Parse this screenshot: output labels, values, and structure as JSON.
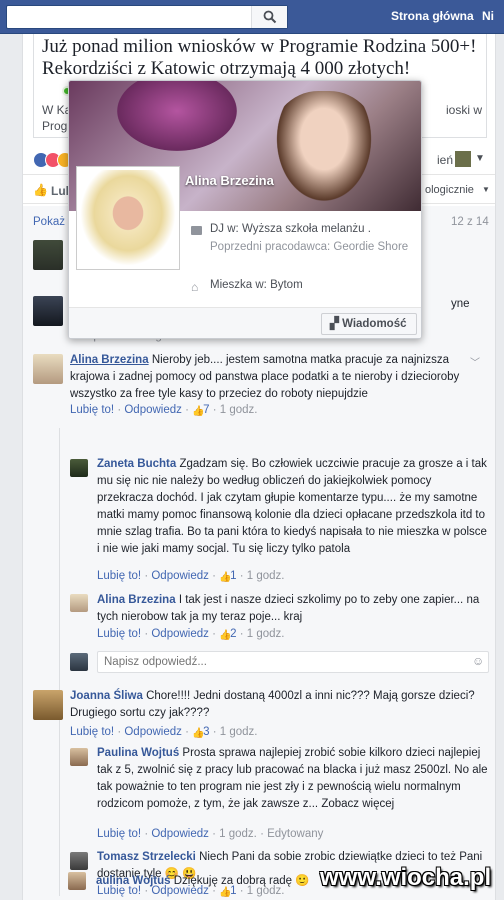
{
  "topbar": {
    "home": "Strona główna",
    "profile_initial": "Ni"
  },
  "post": {
    "title": "Już ponad milion wniosków w Programie Rodzina 500+! Rekordziści z Katowic otrzymają 4 000 złotych!",
    "excerpt_left": "W Ka\nProg",
    "excerpt_right": "ioski w",
    "reactions_right": "ień",
    "share_label": "Lub",
    "sort_label": "ologicznie",
    "show_more": "Pokaż w",
    "count": "12 z 14",
    "partial_text_2": "yne",
    "partial_link": "· Odpowiedz · 1 godz."
  },
  "hover_card": {
    "name": "Alina Brzezina",
    "work": "DJ w: Wyższa szkoła melanżu .",
    "prev_employer": "Poprzedni pracodawca: Geordie Shore",
    "lives": "Mieszka w: Bytom",
    "message_button": "Wiadomość",
    "exclaim": "!"
  },
  "comments": [
    {
      "name": "Alina Brzezina",
      "text": "Nieroby jeb.... jestem samotna matka pracuje za najnizsza krajowa i zadnej pomocy od panstwa place podatki a te nieroby i dziecioroby wszystko za free tyle kasy to przeciez do roboty niepujdzie",
      "like": "Lubię to!",
      "reply": "Odpowiedz",
      "likes": "7",
      "time": "1 godz."
    },
    {
      "name": "Zaneta Buchta",
      "text": "Zgadzam się. Bo człowiek uczciwie pracuje za grosze a i tak mu się nic nie należy bo według obliczeń do jakiejkolwiek pomocy przekracza dochód. I jak czytam głupie komentarze typu.... że my samotne matki mamy pomoc finansową kolonie dla dzieci opłacane przedszkola itd to mnie szlag trafia. Bo ta pani która to kiedyś napisała to nie mieszka w polsce i nie wie jaki mamy socjal. Tu się liczy tylko patola",
      "like": "Lubię to!",
      "reply": "Odpowiedz",
      "likes": "1",
      "time": "1 godz."
    },
    {
      "name": "Alina Brzezina",
      "text": "I tak jest i nasze dzieci szkolimy po to zeby one zapier... na tych nierobow tak ja my teraz poje... kraj",
      "like": "Lubię to!",
      "reply": "Odpowiedz",
      "likes": "2",
      "time": "1 godz."
    },
    {
      "name": "Joanna Śliwa",
      "text": "Chore!!!! Jedni dostaną 4000zl a inni nic??? Mają gorsze dzieci? Drugiego sortu czy jak????",
      "like": "Lubię to!",
      "reply": "Odpowiedz",
      "likes": "3",
      "time": "1 godz."
    },
    {
      "name": "Paulina Wojtuś",
      "text": "Prosta sprawa najlepiej zrobić sobie kilkoro dzieci najlepiej tak z 5, zwolnić się z pracy lub pracować na blacka i już masz 2500zl. No ale tak poważnie to ten program nie jest zły i z pewnością wielu normalnym rodzicom pomoże, z tym, że jak zawsze z... Zobacz więcej",
      "like": "Lubię to!",
      "reply": "Odpowiedz",
      "time": "1 godz.",
      "edited": "Edytowany"
    },
    {
      "name": "Tomasz Strzelecki",
      "text": "Niech Pani da sobie zrobic dziewiątke dzieci to też Pani dostanie tyle 😊 😃",
      "like": "Lubię to!",
      "reply": "Odpowiedz",
      "likes": "1",
      "time": "1 godz."
    },
    {
      "name": "aulina Wojtuś",
      "text": "Dziękuję za dobrą radę 🙂"
    }
  ],
  "reply_input": {
    "placeholder": "Napisz odpowiedź..."
  },
  "watermark": "www.wiocha.pl"
}
